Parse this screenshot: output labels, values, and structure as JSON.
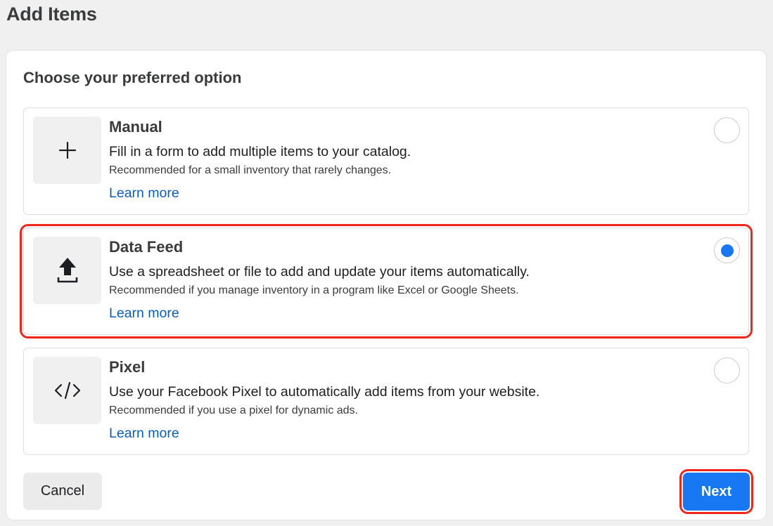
{
  "header": {
    "title": "Add Items"
  },
  "panel": {
    "section_title": "Choose your preferred option",
    "options": [
      {
        "title": "Manual",
        "description": "Fill in a form to add multiple items to your catalog.",
        "recommendation": "Recommended for a small inventory that rarely changes.",
        "link": "Learn more",
        "icon": "plus-icon",
        "selected": false
      },
      {
        "title": "Data Feed",
        "description": "Use a spreadsheet or file to add and update your items automatically.",
        "recommendation": "Recommended if you manage inventory in a program like Excel or Google Sheets.",
        "link": "Learn more",
        "icon": "upload-icon",
        "selected": true
      },
      {
        "title": "Pixel",
        "description": "Use your Facebook Pixel to automatically add items from your website.",
        "recommendation": "Recommended if you use a pixel for dynamic ads.",
        "link": "Learn more",
        "icon": "code-icon",
        "selected": false
      }
    ]
  },
  "footer": {
    "cancel_label": "Cancel",
    "next_label": "Next"
  },
  "colors": {
    "accent": "#1877f2",
    "link": "#0a5dc2",
    "highlight": "#f0261b"
  }
}
